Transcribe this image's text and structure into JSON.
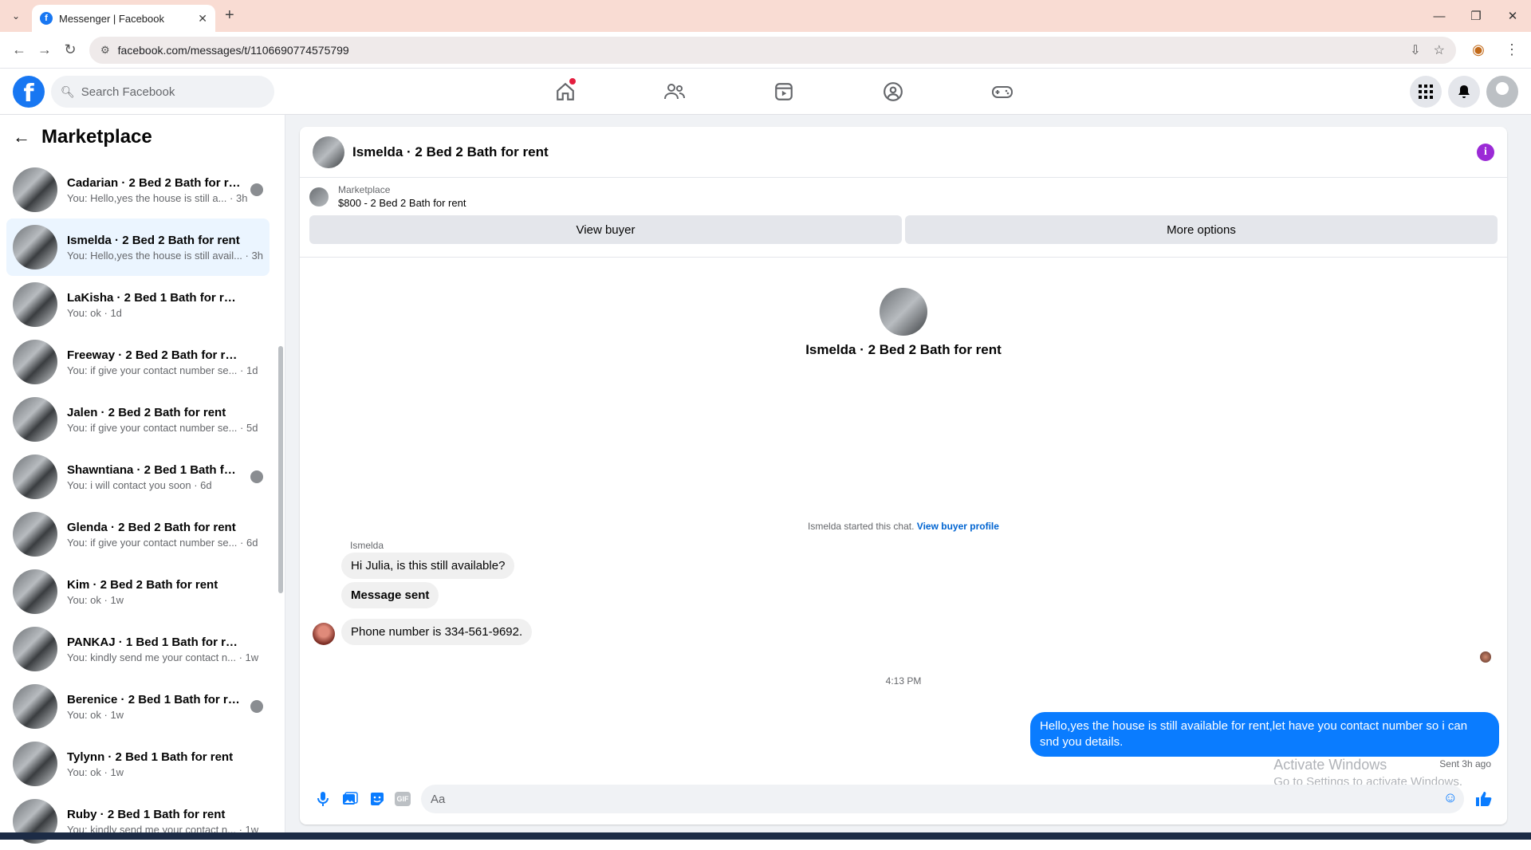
{
  "browser": {
    "tab_title": "Messenger | Facebook",
    "url": "facebook.com/messages/t/1106690774575799"
  },
  "fb": {
    "search_placeholder": "Search Facebook"
  },
  "sidebar": {
    "title": "Marketplace",
    "conversations": [
      {
        "name": "Cadarian · 2 Bed 2 Bath for rent",
        "preview": "You: Hello,yes the house is still a... · 3h",
        "seen": true
      },
      {
        "name": "Ismelda · 2 Bed 2 Bath for rent",
        "preview": "You: Hello,yes the house is still avail... · 3h",
        "seen": false
      },
      {
        "name": "LaKisha · 2 Bed 1 Bath for rent",
        "preview": "You: ok · 1d",
        "seen": false
      },
      {
        "name": "Freeway · 2 Bed 2 Bath for rent",
        "preview": "You: if give your contact number se... · 1d",
        "seen": false
      },
      {
        "name": "Jalen · 2 Bed 2 Bath for rent",
        "preview": "You: if give your contact number se... · 5d",
        "seen": false
      },
      {
        "name": "Shawntiana · 2 Bed 1 Bath for ...",
        "preview": "You: i will contact you soon · 6d",
        "seen": true
      },
      {
        "name": "Glenda · 2 Bed 2 Bath for rent",
        "preview": "You: if give your contact number se... · 6d",
        "seen": false
      },
      {
        "name": "Kim · 2 Bed 2 Bath for rent",
        "preview": "You: ok · 1w",
        "seen": false
      },
      {
        "name": "PANKAJ · 1 Bed 1 Bath for rent",
        "preview": "You: kindly send me your contact n... · 1w",
        "seen": false
      },
      {
        "name": "Berenice · 2 Bed 1 Bath for rent",
        "preview": "You: ok · 1w",
        "seen": true
      },
      {
        "name": "Tylynn · 2 Bed 1 Bath for rent",
        "preview": "You: ok · 1w",
        "seen": false
      },
      {
        "name": "Ruby · 2 Bed 1 Bath for rent",
        "preview": "You: kindly send me your contact n... · 1w",
        "seen": false
      }
    ]
  },
  "chat": {
    "title": "Ismelda · 2 Bed 2 Bath for rent",
    "listing": {
      "label": "Marketplace",
      "title": "$800 - 2 Bed 2 Bath for rent",
      "view_buyer": "View buyer",
      "more_options": "More options"
    },
    "profile_name": "Ismelda · 2 Bed 2 Bath for rent",
    "started_text": "Ismelda started this chat.",
    "started_link": "View buyer profile",
    "sender_name": "Ismelda",
    "messages_in": [
      "Hi Julia, is this still available?",
      "Message sent",
      "Phone number is 334-561-9692."
    ],
    "timestamp": "4:13 PM",
    "message_out": "Hello,yes the house is still available for rent,let have you contact number so i can snd you details.",
    "sent_status": "Sent 3h ago",
    "composer_placeholder": "Aa"
  },
  "watermark": {
    "line1": "Activate Windows",
    "line2": "Go to Settings to activate Windows."
  },
  "colors": {
    "brand": "#1877f2",
    "outgoing_bubble": "#0a7cff",
    "tab_strip": "#f9dcd3"
  }
}
